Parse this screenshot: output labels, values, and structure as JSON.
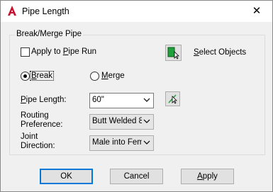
{
  "window": {
    "title": "Pipe Length",
    "close_glyph": "✕"
  },
  "group": {
    "label": "Break/Merge Pipe"
  },
  "apply_to_pipe_run": {
    "label": "Apply to Pipe Run",
    "checked": false
  },
  "select_objects": {
    "label": "Select Objects",
    "icon": "select-objects-icon"
  },
  "mode": {
    "options": [
      {
        "label": "Break",
        "selected": true
      },
      {
        "label": "Merge",
        "selected": false
      }
    ]
  },
  "fields": {
    "pipe_length": {
      "label": "Pipe Length:",
      "value": "60\""
    },
    "routing_preference": {
      "label_line1": "Routing",
      "label_line2": "Preference:",
      "value": "Butt Welded 8"
    },
    "joint_direction": {
      "label_line1": "Joint",
      "label_line2": "Direction:",
      "value": "Male into Fem"
    }
  },
  "buttons": {
    "ok": "OK",
    "cancel": "Cancel",
    "apply": "Apply"
  },
  "colors": {
    "accent": "#0078d7",
    "app_icon_red": "#c8102e",
    "select_icon_green": "#1fa03a"
  }
}
